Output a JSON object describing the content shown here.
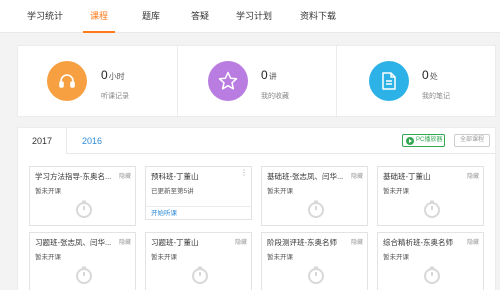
{
  "nav": {
    "tabs": [
      {
        "label": "学习统计"
      },
      {
        "label": "课程"
      },
      {
        "label": "题库"
      },
      {
        "label": "答疑"
      },
      {
        "label": "学习计划"
      },
      {
        "label": "资料下载"
      }
    ],
    "active_index": 1
  },
  "stats": [
    {
      "icon": "headphones-icon",
      "color": "#f7a041",
      "value": "0",
      "unit": "小时",
      "label": "听课记录"
    },
    {
      "icon": "star-icon",
      "color": "#b97ce0",
      "value": "0",
      "unit": "讲",
      "label": "我的收藏"
    },
    {
      "icon": "document-icon",
      "color": "#2cb2e6",
      "value": "0",
      "unit": "处",
      "label": "我的笔记"
    }
  ],
  "courses": {
    "years": [
      "2017",
      "2016"
    ],
    "active_year": "2017",
    "pc_player_label": "PC播放器",
    "all_courses_label": "全部课程",
    "cards": [
      {
        "title": "学习方法指导-东奥名...",
        "hide": "隐藏",
        "status": "暂未开课",
        "has_start": false
      },
      {
        "title": "预科班-丁董山",
        "hide": "",
        "status": "已更新至第5讲",
        "has_start": true,
        "start_label": "开始听课"
      },
      {
        "title": "基础班-张志凤、闫华...",
        "hide": "隐藏",
        "status": "暂未开课",
        "has_start": false
      },
      {
        "title": "基础班-丁董山",
        "hide": "隐藏",
        "status": "暂未开课",
        "has_start": false
      },
      {
        "title": "习题班-张志凤、闫华...",
        "hide": "隐藏",
        "status": "暂未开课",
        "has_start": false
      },
      {
        "title": "习题班-丁董山",
        "hide": "隐藏",
        "status": "暂未开课",
        "has_start": false
      },
      {
        "title": "阶段测评班-东奥名师",
        "hide": "隐藏",
        "status": "暂未开课",
        "has_start": false
      },
      {
        "title": "综合精析班-东奥名师",
        "hide": "隐藏",
        "status": "暂未开课",
        "has_start": false
      }
    ]
  },
  "colors": {
    "accent": "#ff7a1a",
    "link": "#2e8ad8",
    "green": "#34a853"
  }
}
